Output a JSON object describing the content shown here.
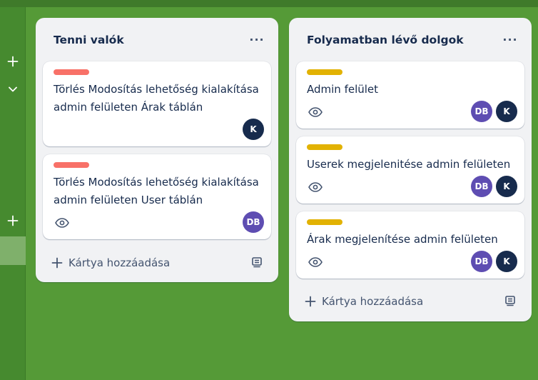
{
  "colors": {
    "board_background": "#559a37",
    "label_red": "#f87168",
    "label_yellow": "#e2b203",
    "avatar_k": "#172b4d",
    "avatar_db": "#5e4db2"
  },
  "sidebar": {
    "add_icon": "plus-icon",
    "collapse_icon": "chevron-down-icon",
    "add_icon_2": "plus-icon"
  },
  "lists": [
    {
      "title": "Tenni valók",
      "menu": "···",
      "add_card_label": "Kártya hozzáadása",
      "cards": [
        {
          "label_color": "red",
          "title": "Törlés Modosítás lehetőség kialakítása admin felületen Árak táblán",
          "has_watch": false,
          "members": [
            "K"
          ]
        },
        {
          "label_color": "red",
          "title": "Törlés Modosítás lehetőség kialakítása admin felületen User táblán",
          "has_watch": true,
          "members": [
            "DB"
          ]
        }
      ]
    },
    {
      "title": "Folyamatban lévő dolgok",
      "menu": "···",
      "add_card_label": "Kártya hozzáadása",
      "cards": [
        {
          "label_color": "yellow",
          "title": "Admin felület",
          "has_watch": true,
          "members": [
            "DB",
            "K"
          ]
        },
        {
          "label_color": "yellow",
          "title": "Userek megjelenitése admin felületen",
          "has_watch": true,
          "members": [
            "DB",
            "K"
          ]
        },
        {
          "label_color": "yellow",
          "title": "Árak megjelenítése admin felületen",
          "has_watch": true,
          "members": [
            "DB",
            "K"
          ]
        }
      ]
    }
  ]
}
